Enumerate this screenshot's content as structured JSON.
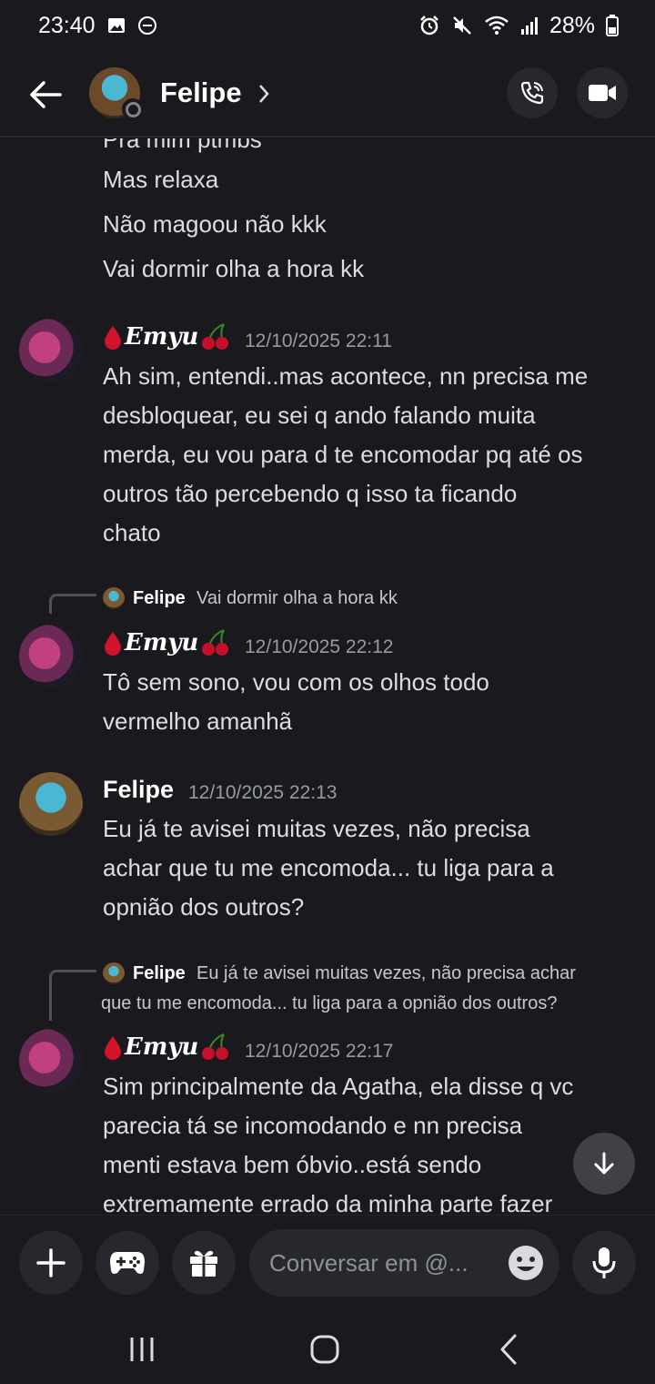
{
  "status_bar": {
    "time": "23:40",
    "battery": "28%"
  },
  "header": {
    "name": "Felipe"
  },
  "chat": {
    "top_cutoff_line": "Pra mim ptmbs",
    "prev_lines": [
      "Mas relaxa",
      "Não magoou não kkk",
      "Vai dormir olha a hora kk"
    ],
    "messages": [
      {
        "author": "Emyu",
        "timestamp": "12/10/2025 22:11",
        "lines": [
          "Ah sim, entendi..mas acontece, nn precisa me",
          "desbloquear, eu sei q ando falando muita",
          "merda, eu vou para d te encomodar pq até os",
          "outros tão percebendo q isso ta ficando",
          "chato"
        ]
      },
      {
        "reply_name": "Felipe",
        "reply_lines": [
          "Vai dormir olha a hora kk"
        ],
        "author": "Emyu",
        "timestamp": "12/10/2025 22:12",
        "lines": [
          "Tô sem sono, vou com os olhos todo",
          "vermelho amanhã"
        ]
      },
      {
        "author": "Felipe",
        "timestamp": "12/10/2025 22:13",
        "lines": [
          "Eu já te avisei muitas vezes, não precisa",
          "achar que tu me encomoda... tu liga para a",
          "opnião dos outros?"
        ]
      },
      {
        "reply_name": "Felipe",
        "reply_lines": [
          "Eu já te avisei muitas vezes, não precisa achar",
          "que tu me encomoda... tu liga para a opnião dos outros?"
        ],
        "author": "Emyu",
        "timestamp": "12/10/2025 22:17",
        "lines": [
          "Sim principalmente da Agatha, ela disse q vc",
          "parecia tá se incomodando e nn precisa",
          "menti estava bem óbvio..está sendo",
          "extremamente errado da minha parte fazer"
        ]
      }
    ]
  },
  "composer": {
    "placeholder": "Conversar em @..."
  },
  "icons": {
    "back": "arrow-left-icon",
    "call": "phone-icon",
    "video": "video-camera-icon",
    "add": "plus-icon",
    "games": "gamepad-icon",
    "gift": "gift-icon",
    "emoji": "smile-icon",
    "mic": "microphone-icon",
    "scroll": "arrow-down-icon"
  },
  "colors": {
    "background": "#1a1a1e",
    "button": "#27282d",
    "text": "#dbdee1",
    "muted": "#949ba4"
  }
}
